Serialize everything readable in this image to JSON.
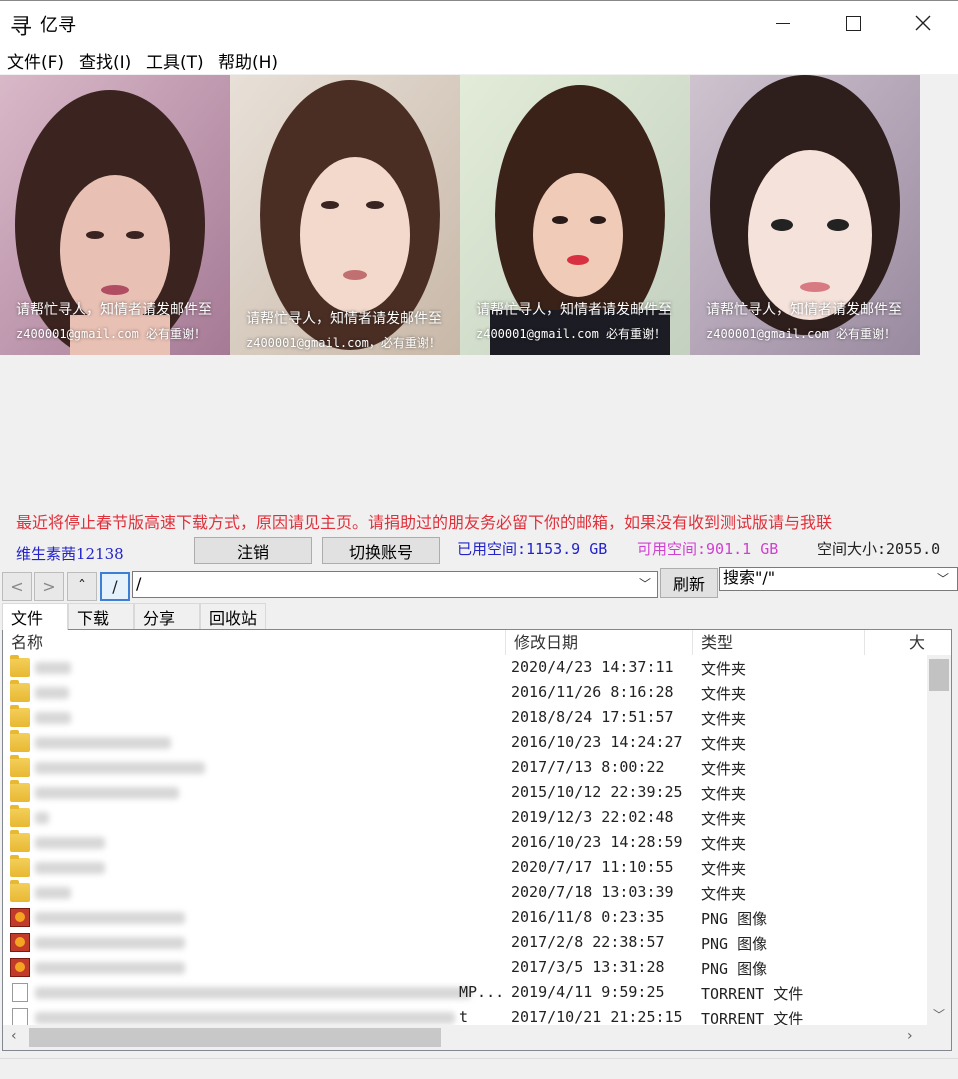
{
  "window": {
    "title": "亿寻",
    "logo_glyph": "寻"
  },
  "menu": [
    {
      "label": "文件(F)"
    },
    {
      "label": "查找(I)"
    },
    {
      "label": "工具(T)"
    },
    {
      "label": "帮助(H)"
    }
  ],
  "banner": {
    "captions": [
      {
        "line1": "请帮忙寻人，知情者请发邮件至",
        "line2": "z400001@gmail.com 必有重谢！"
      },
      {
        "line1": "请帮忙寻人，知情者请发邮件至",
        "line2": "z400001@gmail.com，必有重谢！"
      },
      {
        "line1": "请帮忙寻人，知情者请发邮件至",
        "line2": "z400001@gmail.com 必有重谢！"
      },
      {
        "line1": "请帮忙寻人，知情者请发邮件至",
        "line2": "z400001@gmail.com 必有重谢！"
      }
    ]
  },
  "notice": "最近将停止春节版高速下载方式，原因请见主页。请捐助过的朋友务必留下你的邮箱，如果没有收到测试版请与我联",
  "account": {
    "username": "维生素茜12138",
    "logout_label": "注销",
    "switch_label": "切换账号",
    "space_used": "已用空间:1153.9 GB",
    "space_free": "可用空间:901.1 GB",
    "space_total": "空间大小:2055.0"
  },
  "nav": {
    "back_glyph": "<",
    "forward_glyph": ">",
    "up_glyph": "ˆ",
    "root_label": "/",
    "path_value": "/",
    "refresh_label": "刷新",
    "search_value": "搜索\"/\""
  },
  "tabs": [
    {
      "label": "文件"
    },
    {
      "label": "下载"
    },
    {
      "label": "分享"
    },
    {
      "label": "回收站"
    }
  ],
  "columns": {
    "name": "名称",
    "modified": "修改日期",
    "type": "类型",
    "size": "大"
  },
  "files": [
    {
      "icon": "folder-icon",
      "modified": "2020/4/23 14:37:11",
      "type": "文件夹",
      "tail": ""
    },
    {
      "icon": "folder-icon",
      "modified": "2016/11/26 8:16:28",
      "type": "文件夹",
      "tail": ""
    },
    {
      "icon": "folder-icon",
      "modified": "2018/8/24 17:51:57",
      "type": "文件夹",
      "tail": ""
    },
    {
      "icon": "folder-icon",
      "modified": "2016/10/23 14:24:27",
      "type": "文件夹",
      "tail": ""
    },
    {
      "icon": "folder-icon",
      "modified": "2017/7/13 8:00:22",
      "type": "文件夹",
      "tail": ""
    },
    {
      "icon": "folder-icon",
      "modified": "2015/10/12 22:39:25",
      "type": "文件夹",
      "tail": ""
    },
    {
      "icon": "folder-icon",
      "modified": "2019/12/3 22:02:48",
      "type": "文件夹",
      "tail": ""
    },
    {
      "icon": "folder-icon",
      "modified": "2016/10/23 14:28:59",
      "type": "文件夹",
      "tail": ""
    },
    {
      "icon": "folder-icon",
      "modified": "2020/7/17 11:10:55",
      "type": "文件夹",
      "tail": ""
    },
    {
      "icon": "folder-icon",
      "modified": "2020/7/18 13:03:39",
      "type": "文件夹",
      "tail": ""
    },
    {
      "icon": "png-file-icon",
      "modified": "2016/11/8 0:23:35",
      "type": "PNG 图像",
      "tail": ""
    },
    {
      "icon": "png-file-icon",
      "modified": "2017/2/8 22:38:57",
      "type": "PNG 图像",
      "tail": ""
    },
    {
      "icon": "png-file-icon",
      "modified": "2017/3/5 13:31:28",
      "type": "PNG 图像",
      "tail": ""
    },
    {
      "icon": "file-icon",
      "modified": "2019/4/11 9:59:25",
      "type": "TORRENT 文件",
      "tail": "MP..."
    },
    {
      "icon": "file-icon",
      "modified": "2017/10/21 21:25:15",
      "type": "TORRENT 文件",
      "tail": "t"
    }
  ]
}
